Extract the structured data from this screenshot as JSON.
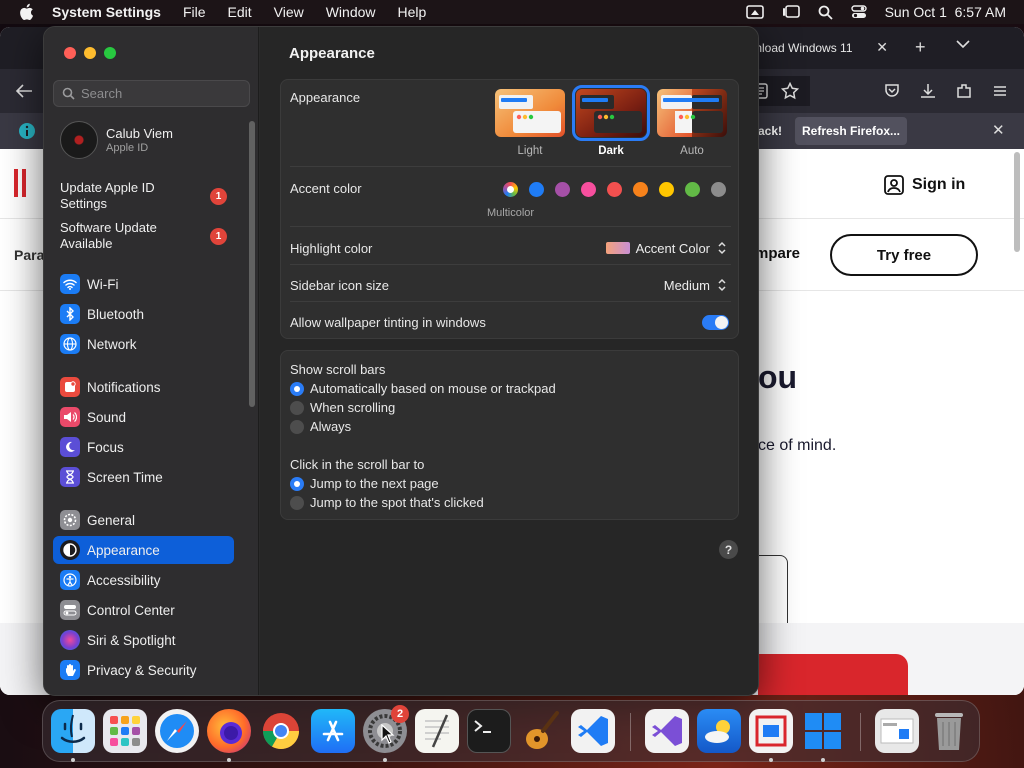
{
  "menubar": {
    "app_name": "System Settings",
    "menus": [
      "File",
      "Edit",
      "View",
      "Window",
      "Help"
    ],
    "clock": "Sun Oct 1  6:57 AM"
  },
  "firefox": {
    "tab_title": "ownload Windows 11",
    "notification_text": "ack!",
    "notification_button": "Refresh Firefox...",
    "page": {
      "signin": "Sign in",
      "compare": "mpare",
      "try_free": "Try free",
      "hero": "ou",
      "subtitle": "ce of mind.",
      "nav_left": "Para"
    }
  },
  "settings": {
    "search_placeholder": "Search",
    "account": {
      "name": "Calub Viem",
      "subtitle": "Apple ID"
    },
    "alerts": [
      {
        "label_line1": "Update Apple ID",
        "label_line2": "Settings",
        "badge": "1"
      },
      {
        "label_line1": "Software Update",
        "label_line2": "Available",
        "badge": "1"
      }
    ],
    "sidebar_items": [
      {
        "label": "Wi-Fi",
        "icon": "wifi-icon",
        "color": "#1b7cf5"
      },
      {
        "label": "Bluetooth",
        "icon": "bluetooth-icon",
        "color": "#1b7cf5"
      },
      {
        "label": "Network",
        "icon": "globe-icon",
        "color": "#1b7cf5"
      },
      {
        "label": "Notifications",
        "icon": "bell-icon",
        "color": "#ea4a3e"
      },
      {
        "label": "Sound",
        "icon": "speaker-icon",
        "color": "#ea4a6a"
      },
      {
        "label": "Focus",
        "icon": "moon-icon",
        "color": "#5b4ed6"
      },
      {
        "label": "Screen Time",
        "icon": "hourglass-icon",
        "color": "#5b4ed6"
      },
      {
        "label": "General",
        "icon": "gear-icon",
        "color": "#8e8e93"
      },
      {
        "label": "Appearance",
        "icon": "appearance-icon",
        "color": "#1c1c1e"
      },
      {
        "label": "Accessibility",
        "icon": "accessibility-icon",
        "color": "#1b7cf5"
      },
      {
        "label": "Control Center",
        "icon": "toggles-icon",
        "color": "#8e8e93"
      },
      {
        "label": "Siri & Spotlight",
        "icon": "siri-icon",
        "color": "#7a3fd0"
      },
      {
        "label": "Privacy & Security",
        "icon": "hand-icon",
        "color": "#1b7cf5"
      }
    ],
    "selected_item": "Appearance",
    "main": {
      "title": "Appearance",
      "appearance_label": "Appearance",
      "appearance_options": [
        "Light",
        "Dark",
        "Auto"
      ],
      "appearance_selected": "Dark",
      "accent_label": "Accent color",
      "accent_colors": [
        "#b5b5b5",
        "#1f7cf5",
        "#a550a7",
        "#f74f9e",
        "#f2504f",
        "#f7821b",
        "#ffc600",
        "#62ba46",
        "#8c8c8c"
      ],
      "accent_selected_name": "Multicolor",
      "highlight_label": "Highlight color",
      "highlight_value": "Accent Color",
      "icon_size_label": "Sidebar icon size",
      "icon_size_value": "Medium",
      "wallpaper_tint_label": "Allow wallpaper tinting in windows",
      "wallpaper_tint_on": true,
      "scrollbars_label": "Show scroll bars",
      "scrollbar_options": [
        "Automatically based on mouse or trackpad",
        "When scrolling",
        "Always"
      ],
      "scrollbar_selected": 0,
      "click_label": "Click in the scroll bar to",
      "click_options": [
        "Jump to the next page",
        "Jump to the spot that's clicked"
      ],
      "click_selected": 0,
      "help": "?"
    }
  },
  "dock": {
    "apps": [
      "Finder",
      "Launchpad",
      "Safari",
      "Firefox",
      "Chrome",
      "App Store",
      "System Settings",
      "TextEdit",
      "Terminal",
      "GarageBand",
      "VS Code",
      "Visual Studio",
      "Weather",
      "Parallels",
      "Windows",
      "Preview",
      "Trash"
    ],
    "settings_badge": "2"
  }
}
